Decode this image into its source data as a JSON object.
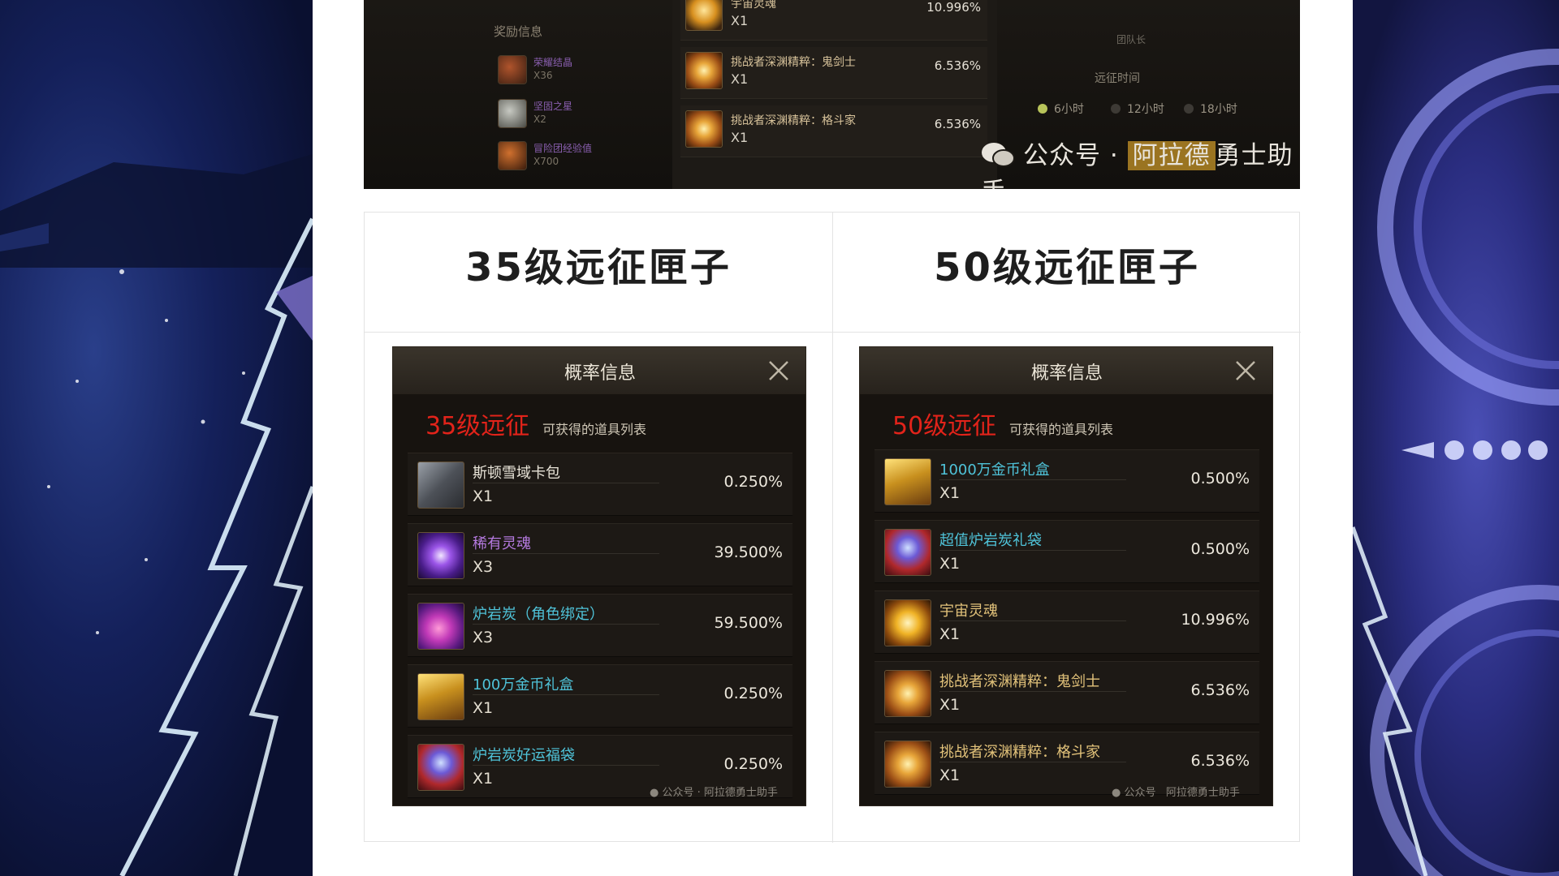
{
  "top_screenshot": {
    "reward_title": "奖励信息",
    "mini_items": [
      {
        "name": "荣耀结晶",
        "qty": "X36",
        "icon": "crystal-icon"
      },
      {
        "name": "坚固之星",
        "qty": "X2",
        "icon": "star-icon"
      },
      {
        "name": "冒险团经验值",
        "qty": "X700",
        "icon": "exp-icon"
      }
    ],
    "rows": [
      {
        "name": "宇宙灵魂",
        "qty": "X1",
        "pct": "10.996%",
        "icon": "cosmic-soul-icon"
      },
      {
        "name": "挑战者深渊精粹：鬼剑士",
        "qty": "X1",
        "pct": "6.536%",
        "icon": "abyss-essence-icon"
      },
      {
        "name": "挑战者深渊精粹：格斗家",
        "qty": "X1",
        "pct": "6.536%",
        "icon": "abyss-essence-icon"
      }
    ],
    "captain_label": "团队长",
    "time_label": "远征时间",
    "time_options": [
      {
        "label": "6小时",
        "selected": true
      },
      {
        "label": "12小时",
        "selected": false
      },
      {
        "label": "18小时",
        "selected": false
      }
    ],
    "watermark_prefix": "公众号",
    "watermark_dot": "·",
    "watermark_name_hl": "阿拉德",
    "watermark_name_rest": "勇士助手"
  },
  "comparison": {
    "left_title": "35级远征匣子",
    "right_title": "50级远征匣子",
    "panels": [
      {
        "title": "概率信息",
        "level": "35级远征",
        "subtitle": "可获得的道具列表",
        "watermark": "公众号 · 阿拉德勇士助手",
        "items": [
          {
            "name": "斯顿雪域卡包",
            "qty": "X1",
            "pct": "0.250%",
            "color": "white",
            "icon": "card-pack-icon"
          },
          {
            "name": "稀有灵魂",
            "qty": "X3",
            "pct": "39.500%",
            "color": "purple",
            "icon": "rare-soul-icon"
          },
          {
            "name": "炉岩炭（角色绑定）",
            "qty": "X3",
            "pct": "59.500%",
            "color": "cyan",
            "icon": "lava-stone-icon"
          },
          {
            "name": "100万金币礼盒",
            "qty": "X1",
            "pct": "0.250%",
            "color": "cyan",
            "icon": "gold-box-icon"
          },
          {
            "name": "炉岩炭好运福袋",
            "qty": "X1",
            "pct": "0.250%",
            "color": "cyan",
            "icon": "lucky-bag-icon"
          }
        ]
      },
      {
        "title": "概率信息",
        "level": "50级远征",
        "subtitle": "可获得的道具列表",
        "watermark_a": "公众号",
        "watermark_b": "阿拉德勇士助手",
        "items": [
          {
            "name": "1000万金币礼盒",
            "qty": "X1",
            "pct": "0.500%",
            "color": "cyan",
            "icon": "gold-box-icon"
          },
          {
            "name": "超值炉岩炭礼袋",
            "qty": "X1",
            "pct": "0.500%",
            "color": "cyan",
            "icon": "lava-bag-icon"
          },
          {
            "name": "宇宙灵魂",
            "qty": "X1",
            "pct": "10.996%",
            "color": "gold",
            "icon": "cosmic-soul-icon"
          },
          {
            "name": "挑战者深渊精粹：鬼剑士",
            "qty": "X1",
            "pct": "6.536%",
            "color": "gold",
            "icon": "abyss-essence-icon"
          },
          {
            "name": "挑战者深渊精粹：格斗家",
            "qty": "X1",
            "pct": "6.536%",
            "color": "gold",
            "icon": "abyss-essence-icon"
          }
        ]
      }
    ]
  },
  "colors": {
    "level_red": "#e2231a",
    "item_cyan": "#4fc3d9",
    "item_purple": "#b57ae0",
    "item_gold": "#e2c27a"
  }
}
